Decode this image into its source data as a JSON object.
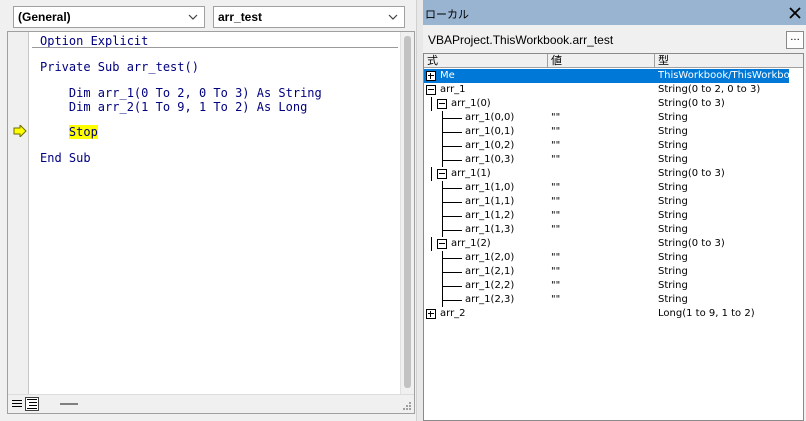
{
  "code_window": {
    "object_combo": "(General)",
    "procedure_combo": "arr_test",
    "lines": [
      "Option Explicit",
      "Private Sub arr_test()",
      "    Dim arr_1(0 To 2, 0 To 3) As String",
      "    Dim arr_2(1 To 9, 1 To 2) As Long",
      "End Sub"
    ],
    "stop_indent": "    ",
    "stop_keyword": "Stop"
  },
  "locals": {
    "title": "ローカル",
    "context": "VBAProject.ThisWorkbook.arr_test",
    "browse_label": "...",
    "columns": {
      "expression": "式",
      "value": "値",
      "type": "型"
    },
    "rows": [
      {
        "expr": "Me",
        "value": "",
        "type": "ThisWorkbook/ThisWorkbook"
      },
      {
        "expr": "arr_1",
        "value": "",
        "type": "String(0 to 2, 0 to 3)"
      },
      {
        "expr": "arr_1(0)",
        "value": "",
        "type": "String(0 to 3)"
      },
      {
        "expr": "arr_1(0,0)",
        "value": "\"\"",
        "type": "String"
      },
      {
        "expr": "arr_1(0,1)",
        "value": "\"\"",
        "type": "String"
      },
      {
        "expr": "arr_1(0,2)",
        "value": "\"\"",
        "type": "String"
      },
      {
        "expr": "arr_1(0,3)",
        "value": "\"\"",
        "type": "String"
      },
      {
        "expr": "arr_1(1)",
        "value": "",
        "type": "String(0 to 3)"
      },
      {
        "expr": "arr_1(1,0)",
        "value": "\"\"",
        "type": "String"
      },
      {
        "expr": "arr_1(1,1)",
        "value": "\"\"",
        "type": "String"
      },
      {
        "expr": "arr_1(1,2)",
        "value": "\"\"",
        "type": "String"
      },
      {
        "expr": "arr_1(1,3)",
        "value": "\"\"",
        "type": "String"
      },
      {
        "expr": "arr_1(2)",
        "value": "",
        "type": "String(0 to 3)"
      },
      {
        "expr": "arr_1(2,0)",
        "value": "\"\"",
        "type": "String"
      },
      {
        "expr": "arr_1(2,1)",
        "value": "\"\"",
        "type": "String"
      },
      {
        "expr": "arr_1(2,2)",
        "value": "\"\"",
        "type": "String"
      },
      {
        "expr": "arr_1(2,3)",
        "value": "\"\"",
        "type": "String"
      },
      {
        "expr": "arr_2",
        "value": "",
        "type": "Long(1 to 9, 1 to 2)"
      }
    ]
  },
  "colors": {
    "title_bar": "#99b4d1",
    "selection": "#0078d7",
    "code_text": "#00007f",
    "stop_highlight": "#ffff00",
    "exec_arrow": "#ffff00"
  }
}
